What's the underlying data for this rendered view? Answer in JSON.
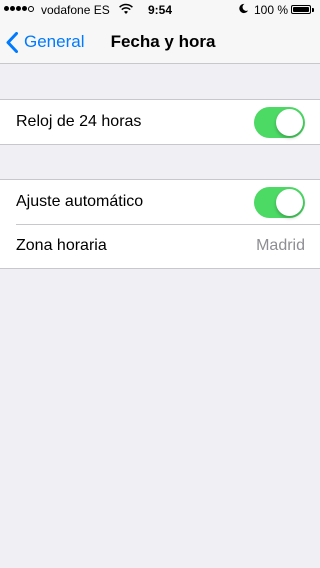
{
  "status_bar": {
    "carrier": "vodafone ES",
    "time": "9:54",
    "battery": "100 %",
    "signal_bars_filled": 4,
    "signal_bars_total": 5,
    "icons": [
      "signal-icon",
      "wifi-icon",
      "moon-icon",
      "battery-icon"
    ]
  },
  "nav": {
    "back_label": "General",
    "title": "Fecha y hora",
    "accent": "#007aff"
  },
  "settings": {
    "group1": {
      "clock_24h": {
        "label": "Reloj de 24 horas",
        "on": true
      }
    },
    "group2": {
      "auto_set": {
        "label": "Ajuste automático",
        "on": true
      },
      "time_zone": {
        "label": "Zona horaria",
        "value": "Madrid"
      }
    }
  },
  "colors": {
    "toggle_on": "#4cd964",
    "background": "#efeff4",
    "secondary_text": "#8e8e93"
  }
}
